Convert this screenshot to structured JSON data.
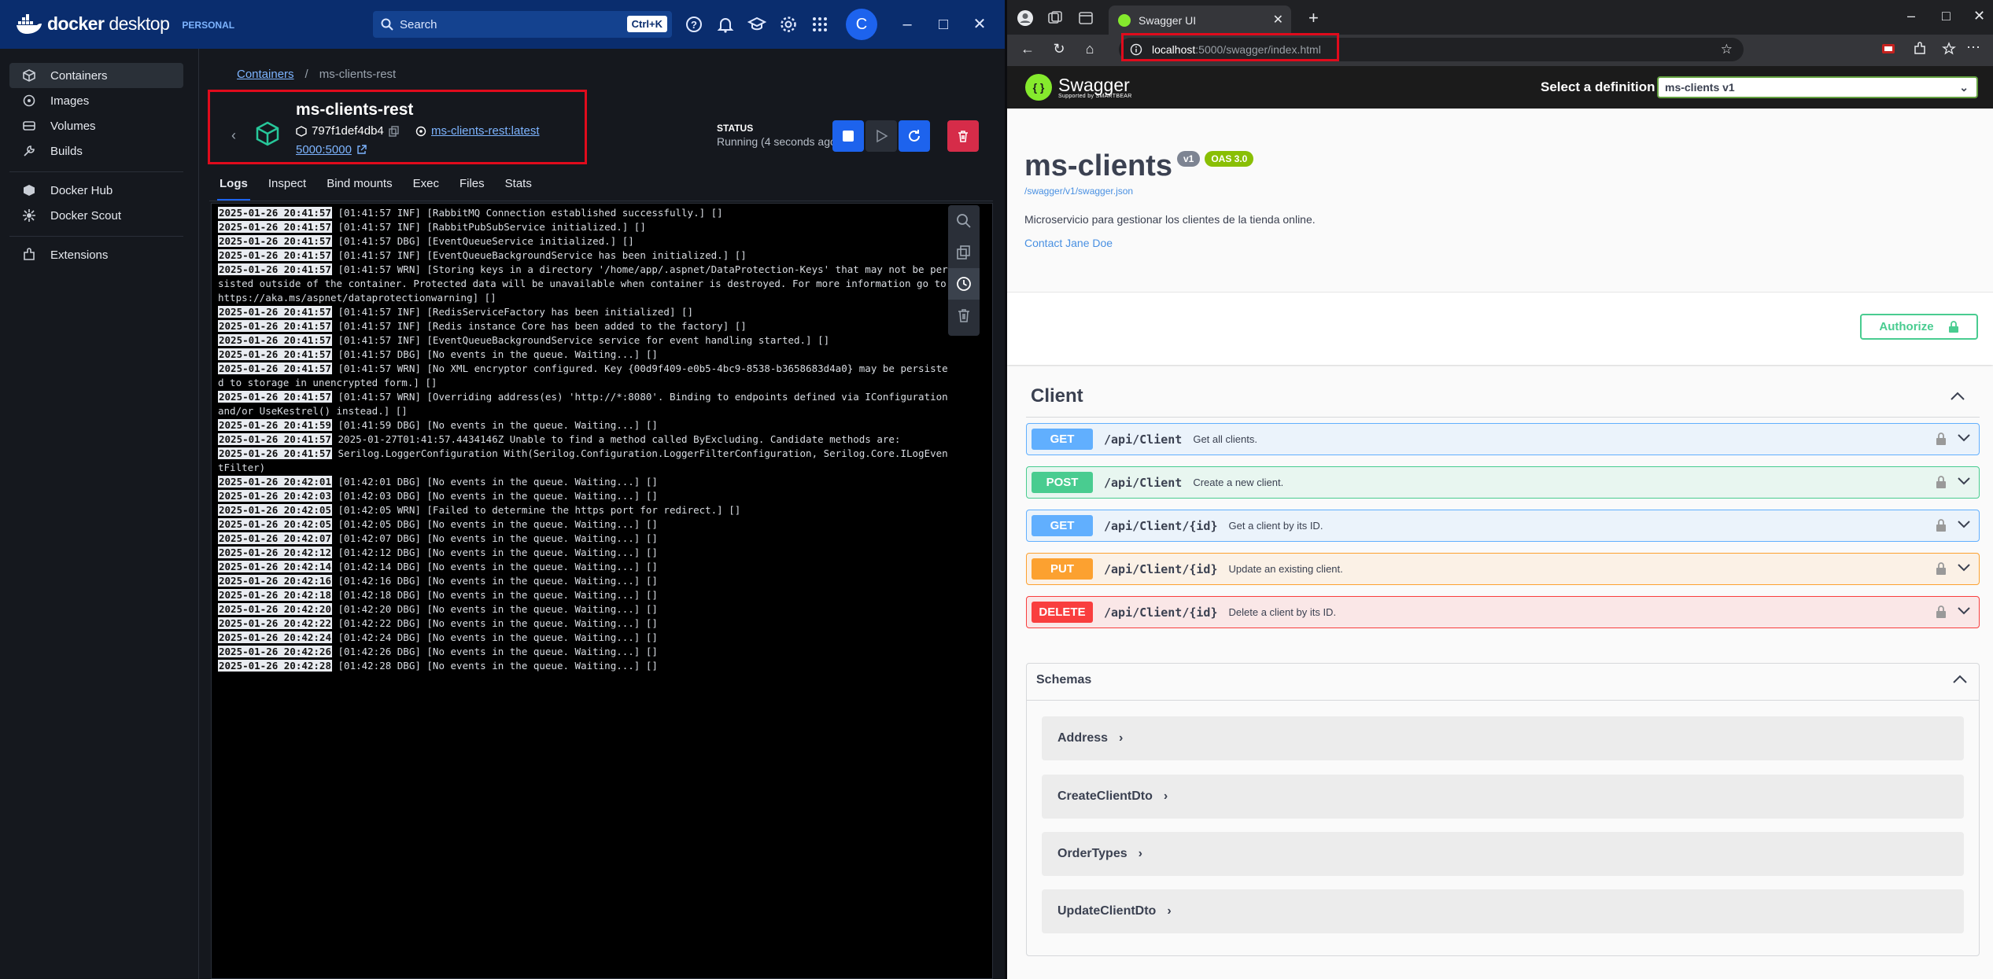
{
  "docker": {
    "brand": "docker",
    "brand_suffix": "desktop",
    "plan": "PERSONAL",
    "search_label": "Search",
    "search_shortcut": "Ctrl+K",
    "avatar_letter": "C",
    "sidebar": [
      {
        "label": "Containers",
        "icon": "containers-icon",
        "active": true
      },
      {
        "label": "Images",
        "icon": "images-icon"
      },
      {
        "label": "Volumes",
        "icon": "volumes-icon"
      },
      {
        "label": "Builds",
        "icon": "builds-icon"
      },
      {
        "label": "Docker Hub",
        "icon": "docker-hub-icon"
      },
      {
        "label": "Docker Scout",
        "icon": "docker-scout-icon"
      },
      {
        "label": "Extensions",
        "icon": "extensions-icon"
      }
    ],
    "breadcrumb": {
      "root": "Containers",
      "current": "ms-clients-rest"
    },
    "container": {
      "name": "ms-clients-rest",
      "id": "797f1def4db4",
      "image": "ms-clients-rest:latest",
      "port": "5000:5000"
    },
    "status": {
      "label": "STATUS",
      "value": "Running (4 seconds ago)"
    },
    "tabs": [
      "Logs",
      "Inspect",
      "Bind mounts",
      "Exec",
      "Files",
      "Stats"
    ],
    "logs": [
      {
        "ts": "2025-01-26 20:41:57",
        "msg": " [01:41:57 INF] [RabbitMQ Connection established successfully.] []"
      },
      {
        "ts": "2025-01-26 20:41:57",
        "msg": " [01:41:57 INF] [RabbitPubSubService initialized.] []"
      },
      {
        "ts": "2025-01-26 20:41:57",
        "msg": " [01:41:57 DBG] [EventQueueService initialized.] []"
      },
      {
        "ts": "2025-01-26 20:41:57",
        "msg": " [01:41:57 INF] [EventQueueBackgroundService has been initialized.] []"
      },
      {
        "ts": "2025-01-26 20:41:57",
        "msg": " [01:41:57 WRN] [Storing keys in a directory '/home/app/.aspnet/DataProtection-Keys' that may not be persisted outside of the container. Protected data will be unavailable when container is destroyed. For more information go to https://aka.ms/aspnet/dataprotectionwarning] []"
      },
      {
        "ts": "2025-01-26 20:41:57",
        "msg": " [01:41:57 INF] [RedisServiceFactory has been initialized] []"
      },
      {
        "ts": "2025-01-26 20:41:57",
        "msg": " [01:41:57 INF] [Redis instance Core has been added to the factory] []"
      },
      {
        "ts": "2025-01-26 20:41:57",
        "msg": " [01:41:57 INF] [EventQueueBackgroundService service for event handling started.] []"
      },
      {
        "ts": "2025-01-26 20:41:57",
        "msg": " [01:41:57 DBG] [No events in the queue. Waiting...] []"
      },
      {
        "ts": "2025-01-26 20:41:57",
        "msg": " [01:41:57 WRN] [No XML encryptor configured. Key {00d9f409-e0b5-4bc9-8538-b3658683d4a0} may be persisted to storage in unencrypted form.] []"
      },
      {
        "ts": "2025-01-26 20:41:57",
        "msg": " [01:41:57 WRN] [Overriding address(es) 'http://*:8080'. Binding to endpoints defined via IConfiguration and/or UseKestrel() instead.] []"
      },
      {
        "ts": "2025-01-26 20:41:59",
        "msg": " [01:41:59 DBG] [No events in the queue. Waiting...] []"
      },
      {
        "ts": "2025-01-26 20:41:57",
        "msg": " 2025-01-27T01:41:57.4434146Z Unable to find a method called ByExcluding. Candidate methods are:"
      },
      {
        "ts": "2025-01-26 20:41:57",
        "msg": " Serilog.LoggerConfiguration With(Serilog.Configuration.LoggerFilterConfiguration, Serilog.Core.ILogEventFilter)"
      },
      {
        "ts": "2025-01-26 20:42:01",
        "msg": " [01:42:01 DBG] [No events in the queue. Waiting...] []"
      },
      {
        "ts": "2025-01-26 20:42:03",
        "msg": " [01:42:03 DBG] [No events in the queue. Waiting...] []"
      },
      {
        "ts": "2025-01-26 20:42:05",
        "msg": " [01:42:05 WRN] [Failed to determine the https port for redirect.] []"
      },
      {
        "ts": "2025-01-26 20:42:05",
        "msg": " [01:42:05 DBG] [No events in the queue. Waiting...] []"
      },
      {
        "ts": "2025-01-26 20:42:07",
        "msg": " [01:42:07 DBG] [No events in the queue. Waiting...] []"
      },
      {
        "ts": "2025-01-26 20:42:12",
        "msg": " [01:42:12 DBG] [No events in the queue. Waiting...] []"
      },
      {
        "ts": "2025-01-26 20:42:14",
        "msg": " [01:42:14 DBG] [No events in the queue. Waiting...] []"
      },
      {
        "ts": "2025-01-26 20:42:16",
        "msg": " [01:42:16 DBG] [No events in the queue. Waiting...] []"
      },
      {
        "ts": "2025-01-26 20:42:18",
        "msg": " [01:42:18 DBG] [No events in the queue. Waiting...] []"
      },
      {
        "ts": "2025-01-26 20:42:20",
        "msg": " [01:42:20 DBG] [No events in the queue. Waiting...] []"
      },
      {
        "ts": "2025-01-26 20:42:22",
        "msg": " [01:42:22 DBG] [No events in the queue. Waiting...] []"
      },
      {
        "ts": "2025-01-26 20:42:24",
        "msg": " [01:42:24 DBG] [No events in the queue. Waiting...] []"
      },
      {
        "ts": "2025-01-26 20:42:26",
        "msg": " [01:42:26 DBG] [No events in the queue. Waiting...] []"
      },
      {
        "ts": "2025-01-26 20:42:28",
        "msg": " [01:42:28 DBG] [No events in the queue. Waiting...] []"
      }
    ]
  },
  "browser": {
    "tab_title": "Swagger UI",
    "url_host": "localhost",
    "url_path": ":5000/swagger/index.html"
  },
  "swagger": {
    "brand": "Swagger",
    "brand_sub": "Supported by SMARTBEAR",
    "definition_label": "Select a definition",
    "definition_value": "ms-clients v1",
    "title": "ms-clients",
    "version_badge": "v1",
    "oas_badge": "OAS 3.0",
    "json_link": "/swagger/v1/swagger.json",
    "description": "Microservicio para gestionar los clientes de la tienda online.",
    "contact": "Contact Jane Doe",
    "authorize_label": "Authorize",
    "tag": "Client",
    "operations": [
      {
        "method": "GET",
        "path": "/api/Client",
        "summary": "Get all clients."
      },
      {
        "method": "POST",
        "path": "/api/Client",
        "summary": "Create a new client."
      },
      {
        "method": "GET",
        "path": "/api/Client/{id}",
        "summary": "Get a client by its ID."
      },
      {
        "method": "PUT",
        "path": "/api/Client/{id}",
        "summary": "Update an existing client."
      },
      {
        "method": "DELETE",
        "path": "/api/Client/{id}",
        "summary": "Delete a client by its ID."
      }
    ],
    "schemas_label": "Schemas",
    "schemas": [
      "Address",
      "CreateClientDto",
      "OrderTypes",
      "UpdateClientDto"
    ]
  },
  "colors": {
    "docker_blue": "#1d63ed",
    "get": "#61affe",
    "post": "#49cc90",
    "put": "#fca130",
    "delete": "#f93e3e",
    "highlight": "#e00b1c"
  }
}
